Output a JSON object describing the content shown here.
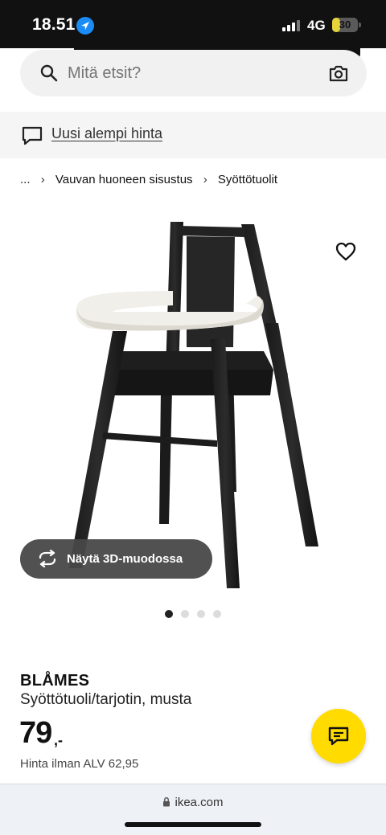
{
  "status_bar": {
    "time": "18.51",
    "network": "4G",
    "battery": "30",
    "battery_level": 0.3
  },
  "search": {
    "placeholder": "Mitä etsit?",
    "search_icon": "search-icon",
    "camera_icon": "camera-icon"
  },
  "banner": {
    "icon": "chat-bubble-icon",
    "link_text": "Uusi alempi hinta"
  },
  "breadcrumb": {
    "items": [
      "...",
      "Vauvan huoneen sisustus",
      "Syöttötuolit"
    ]
  },
  "product_image": {
    "favorite_icon": "heart-icon",
    "view_3d_label": "Näytä 3D-muodossa",
    "view_3d_icon": "rotate-icon",
    "carousel_count": 4,
    "carousel_active_index": 0
  },
  "product": {
    "name": "BLÅMES",
    "description": "Syöttötuoli/tarjotin, musta",
    "price": "79",
    "price_suffix": ",-",
    "vat_text": "Hinta ilman ALV 62,95"
  },
  "chat_button": {
    "icon": "chat-icon"
  },
  "browser": {
    "url": "ikea.com"
  },
  "colors": {
    "accent_yellow": "#ffdb00",
    "status_blue": "#1b8cf5"
  }
}
